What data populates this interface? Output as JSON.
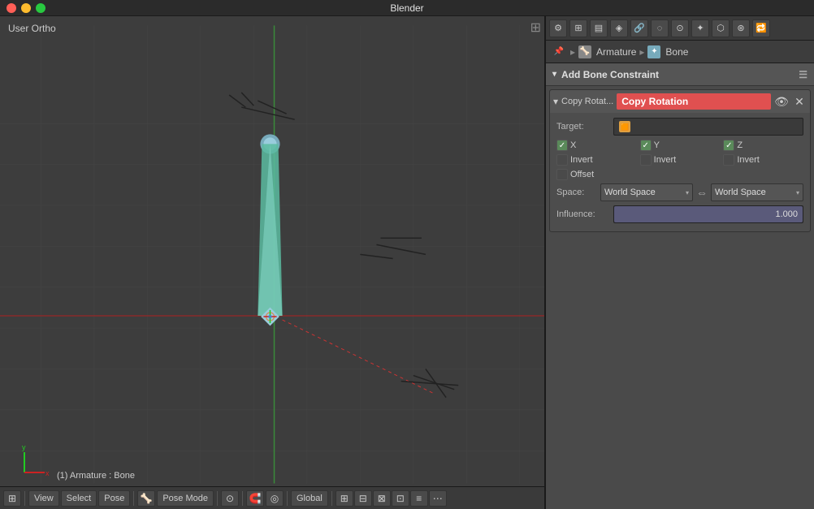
{
  "titlebar": {
    "title": "Blender"
  },
  "viewport": {
    "label": "User Ortho",
    "status": "(1) Armature : Bone",
    "toolbar": {
      "view_label": "View",
      "select_label": "Select",
      "pose_label": "Pose",
      "mode_label": "Pose Mode",
      "global_label": "Global"
    }
  },
  "right_panel": {
    "breadcrumb": {
      "armature_label": "Armature",
      "bone_label": "Bone"
    },
    "add_constraint_label": "Add Bone Constraint",
    "constraint": {
      "name_abbr": "Copy Rotat...",
      "name_full": "Copy Rotation",
      "target_label": "Target:",
      "target_placeholder": "",
      "x_label": "X",
      "y_label": "Y",
      "z_label": "Z",
      "x_checked": true,
      "y_checked": true,
      "z_checked": true,
      "invert_label": "Invert",
      "invert_x_checked": false,
      "invert_y_checked": false,
      "invert_z_checked": false,
      "offset_label": "Offset",
      "offset_checked": false,
      "space_label": "Space:",
      "space_from": "World Space",
      "space_to": "World Space",
      "influence_label": "Influence:",
      "influence_value": "1.000",
      "influence_pct": 100
    }
  },
  "icons": {
    "eye": "👁",
    "close": "✕",
    "collapse": "▾",
    "arrow_right": "▸",
    "swap": "⇔"
  }
}
